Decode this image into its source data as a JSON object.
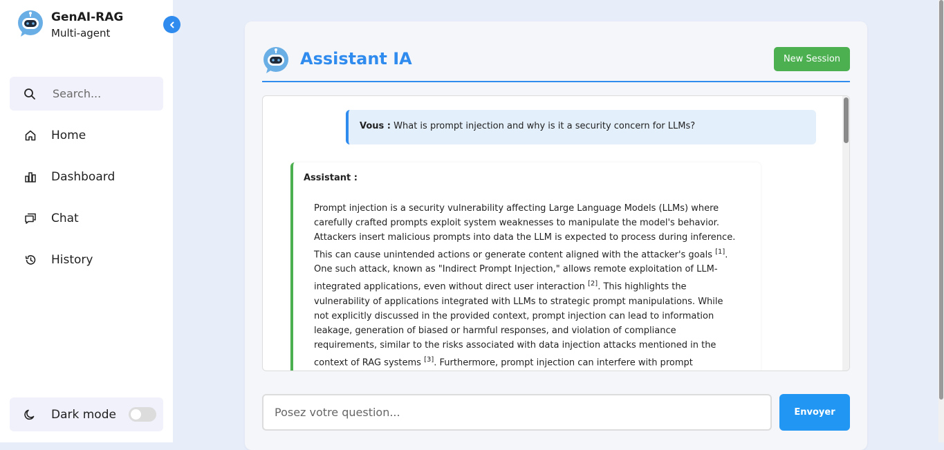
{
  "brand": {
    "title": "GenAI-RAG",
    "subtitle": "Multi-agent"
  },
  "search": {
    "placeholder": "Search..."
  },
  "nav": [
    {
      "label": "Home",
      "icon": "home-icon"
    },
    {
      "label": "Dashboard",
      "icon": "bar-chart-icon"
    },
    {
      "label": "Chat",
      "icon": "chat-icon"
    },
    {
      "label": "History",
      "icon": "history-icon"
    }
  ],
  "dark_mode": {
    "label": "Dark mode",
    "enabled": false
  },
  "panel": {
    "title": "Assistant IA",
    "new_session_label": "New Session"
  },
  "messages": {
    "user": {
      "sender": "Vous :",
      "text": "What is prompt injection and why is it a security concern for LLMs?"
    },
    "assistant": {
      "sender": "Assistant :",
      "p1": "Prompt injection is a security vulnerability affecting Large Language Models (LLMs) where carefully crafted prompts exploit system weaknesses to manipulate the model's behavior. Attackers insert malicious prompts into data the LLM is expected to process during inference. This can cause unintended actions or generate content aligned with the attacker's goals ",
      "ref1": "[1]",
      "p2": ". One such attack, known as \"Indirect Prompt Injection,\" allows remote exploitation of LLM-integrated applications, even without direct user interaction ",
      "ref2": "[2]",
      "p3": ". This highlights the vulnerability of applications integrated with LLMs to strategic prompt manipulations. While not explicitly discussed in the provided context, prompt injection can lead to information leakage, generation of biased or harmful responses, and violation of compliance requirements, similar to the risks associated with data injection attacks mentioned in the context of RAG systems ",
      "ref3": "[3]",
      "p4": ".  Furthermore, prompt injection can interfere with prompt"
    }
  },
  "composer": {
    "placeholder": "Posez votre question...",
    "send_label": "Envoyer"
  },
  "colors": {
    "accent": "#2f8bee",
    "success": "#4caf50",
    "send": "#2196f3"
  }
}
